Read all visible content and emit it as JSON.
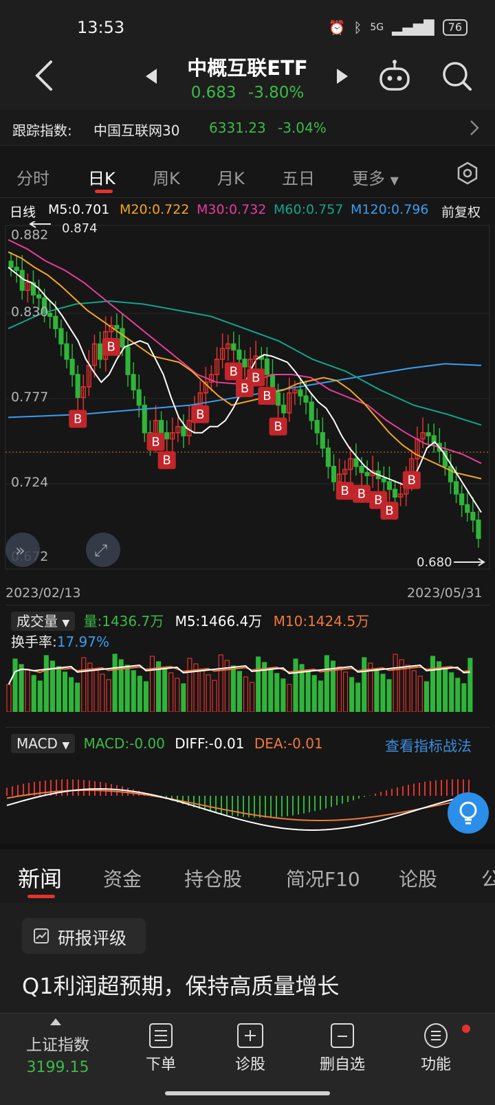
{
  "status": {
    "time": "13:53",
    "battery": "76",
    "network": "5G"
  },
  "header": {
    "title": "中概互联ETF",
    "price": "0.683",
    "change": "-3.80%"
  },
  "tracking": {
    "label": "跟踪指数:",
    "index_name": "中国互联网30",
    "index_value": "6331.23",
    "index_change": "-3.04%"
  },
  "period_tabs": [
    "分时",
    "日K",
    "周K",
    "月K",
    "五日",
    "更多"
  ],
  "active_period": "日K",
  "ma": {
    "line": "日线",
    "m5": "M5:0.701",
    "m20": "M20:0.722",
    "m30": "M30:0.732",
    "m60": "M60:0.757",
    "m120": "M120:0.796",
    "adjust": "前复权"
  },
  "price_axis": {
    "y1": "0.882",
    "y2": "0.830",
    "y3": "0.777",
    "y4": "0.724",
    "y5": "0.672"
  },
  "markers": {
    "high": "0.874",
    "low": "0.680",
    "start_date": "2023/02/13",
    "end_date": "2023/05/31",
    "buy_label": "B"
  },
  "volume": {
    "selector": "成交量",
    "vol": "量:1436.7万",
    "m5": "M5:1466.4万",
    "m10": "M10:1424.5万",
    "turnover_label": "换手率:",
    "turnover": "17.97%"
  },
  "macd": {
    "selector": "MACD",
    "macd": "MACD:-0.00",
    "diff": "DIFF:-0.01",
    "dea": "DEA:-0.01",
    "link": "查看指标战法"
  },
  "news_tabs": [
    "新闻",
    "资金",
    "持仓股",
    "简况F10",
    "论股",
    "公"
  ],
  "news": {
    "tag": "研报评级",
    "headline": "Q1利润超预期，保持高质量增长"
  },
  "nav": {
    "index_name": "上证指数",
    "index_value": "3199.15",
    "items": [
      "下单",
      "诊股",
      "删自选",
      "功能"
    ]
  },
  "colors": {
    "up": "#e5322e",
    "down": "#2fb53a",
    "m5": "#ffffff",
    "m20": "#f5a623",
    "m30": "#e83d9a",
    "m60": "#12a58a",
    "m120": "#3a9ef0"
  },
  "chart_data": {
    "type": "candlestick",
    "x_start": "2023/02/13",
    "x_end": "2023/05/31",
    "ylim": [
      0.672,
      0.882
    ],
    "closes": [
      0.86,
      0.858,
      0.845,
      0.85,
      0.842,
      0.84,
      0.83,
      0.828,
      0.82,
      0.81,
      0.8,
      0.79,
      0.775,
      0.782,
      0.796,
      0.81,
      0.8,
      0.818,
      0.822,
      0.82,
      0.808,
      0.79,
      0.78,
      0.77,
      0.752,
      0.745,
      0.76,
      0.752,
      0.748,
      0.752,
      0.756,
      0.75,
      0.76,
      0.77,
      0.778,
      0.785,
      0.79,
      0.8,
      0.807,
      0.81,
      0.806,
      0.8,
      0.795,
      0.8,
      0.802,
      0.8,
      0.79,
      0.778,
      0.77,
      0.765,
      0.778,
      0.78,
      0.776,
      0.772,
      0.76,
      0.752,
      0.742,
      0.73,
      0.72,
      0.725,
      0.728,
      0.735,
      0.73,
      0.726,
      0.724,
      0.727,
      0.722,
      0.72,
      0.715,
      0.71,
      0.712,
      0.72,
      0.735,
      0.748,
      0.752,
      0.75,
      0.745,
      0.74,
      0.73,
      0.72,
      0.712,
      0.705,
      0.7,
      0.695,
      0.683
    ],
    "m5": [
      0.86,
      0.856,
      0.852,
      0.85,
      0.846,
      0.84,
      0.835,
      0.828,
      0.82,
      0.812,
      0.8,
      0.792,
      0.785,
      0.79,
      0.8,
      0.808,
      0.81,
      0.812,
      0.81,
      0.8,
      0.79,
      0.775,
      0.762,
      0.755,
      0.752,
      0.752,
      0.756,
      0.756,
      0.76,
      0.768,
      0.778,
      0.79,
      0.8,
      0.803,
      0.802,
      0.8,
      0.798,
      0.792,
      0.785,
      0.778,
      0.772,
      0.768,
      0.76,
      0.75,
      0.742,
      0.736,
      0.73,
      0.726,
      0.724,
      0.722,
      0.72,
      0.718,
      0.72,
      0.73,
      0.742,
      0.746,
      0.74,
      0.732,
      0.724,
      0.716,
      0.708,
      0.7
    ],
    "m20": [
      0.87,
      0.866,
      0.86,
      0.855,
      0.848,
      0.84,
      0.832,
      0.826,
      0.82,
      0.814,
      0.808,
      0.802,
      0.8,
      0.798,
      0.792,
      0.784,
      0.776,
      0.77,
      0.772,
      0.774,
      0.778,
      0.78,
      0.784,
      0.786,
      0.788,
      0.786,
      0.78,
      0.772,
      0.762,
      0.752,
      0.744,
      0.738,
      0.734,
      0.73,
      0.726,
      0.724,
      0.722
    ],
    "m30": [
      0.878,
      0.872,
      0.864,
      0.858,
      0.85,
      0.84,
      0.83,
      0.82,
      0.81,
      0.8,
      0.79,
      0.785,
      0.784,
      0.786,
      0.79,
      0.79,
      0.788,
      0.78,
      0.775,
      0.77,
      0.76,
      0.752,
      0.745,
      0.742,
      0.738,
      0.732
    ],
    "m60": [
      0.82,
      0.83,
      0.836,
      0.838,
      0.836,
      0.832,
      0.828,
      0.82,
      0.812,
      0.8,
      0.792,
      0.78,
      0.77,
      0.764,
      0.757
    ],
    "m120": [
      0.762,
      0.763,
      0.764,
      0.766,
      0.768,
      0.77,
      0.774,
      0.778,
      0.782,
      0.786,
      0.79,
      0.794,
      0.797,
      0.796
    ],
    "buy_signals": [
      12,
      18,
      26,
      28,
      34,
      40,
      42,
      44,
      46,
      48,
      60,
      63,
      66,
      68,
      72
    ]
  }
}
